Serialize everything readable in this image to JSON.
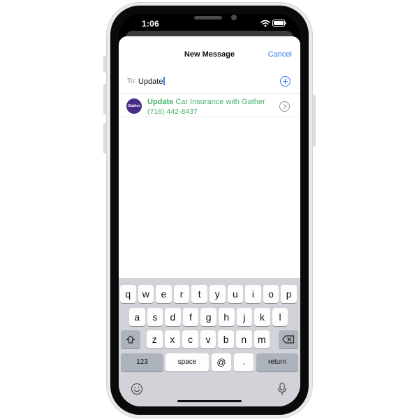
{
  "status_bar": {
    "time": "1:06"
  },
  "compose": {
    "title": "New Message",
    "cancel_label": "Cancel",
    "to_label": "To:",
    "to_value": "Update"
  },
  "suggestion": {
    "avatar_text": "Gather",
    "match_text": "Update",
    "rest_text": " Car Insurance with Gather",
    "phone": "(716) 442-8437"
  },
  "keyboard": {
    "row1": [
      "q",
      "w",
      "e",
      "r",
      "t",
      "y",
      "u",
      "i",
      "o",
      "p"
    ],
    "row2": [
      "a",
      "s",
      "d",
      "f",
      "g",
      "h",
      "j",
      "k",
      "l"
    ],
    "row3": [
      "z",
      "x",
      "c",
      "v",
      "b",
      "n",
      "m"
    ],
    "numbers_label": "123",
    "space_label": "space",
    "at_label": "@",
    "dot_label": ".",
    "return_label": "return"
  },
  "colors": {
    "accent": "#2f7cf6",
    "suggestion_green": "#45b36b",
    "avatar_bg": "#4a2d86",
    "keyboard_bg": "#d1d3d8"
  },
  "icons": {
    "add": "plus-circle-icon",
    "detail": "chevron-right-circle-icon",
    "shift": "shift-arrow-icon",
    "delete": "backspace-icon",
    "emoji": "emoji-icon",
    "dictation": "microphone-icon"
  }
}
